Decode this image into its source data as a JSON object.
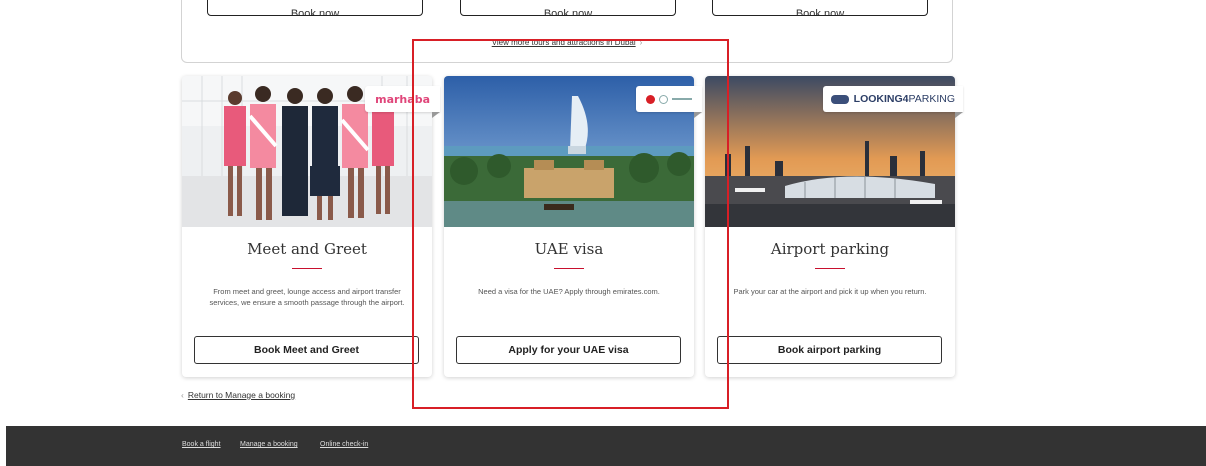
{
  "top_section": {
    "buttons": [
      "Book now",
      "Book now",
      "Book now"
    ],
    "view_more": "View more tours and attractions in Dubai",
    "view_more_chevron": "›"
  },
  "cards": [
    {
      "title": "Meet and Greet",
      "description": "From meet and greet, lounge access and airport transfer services, we ensure a smooth passage through the airport.",
      "button": "Book Meet and Greet",
      "logo": "marhaba"
    },
    {
      "title": "UAE visa",
      "description": "Need a visa for the UAE? Apply through emirates.com.",
      "button": "Apply for your UAE visa",
      "logo": "visa-partners-logo"
    },
    {
      "title": "Airport parking",
      "description": "Park your car at the airport and pick it up when you return.",
      "button": "Book airport parking",
      "logo_bold": "LOOKING4",
      "logo_light": "PARKING"
    }
  ],
  "return_link": "Return to Manage a booking",
  "return_chevron": "‹",
  "footer": {
    "links": [
      "Book a flight",
      "Manage a booking",
      "Online check-in"
    ]
  },
  "colors": {
    "accent_red": "#c8102e",
    "highlight_red": "#d81f26",
    "footer_bg": "#333333"
  }
}
